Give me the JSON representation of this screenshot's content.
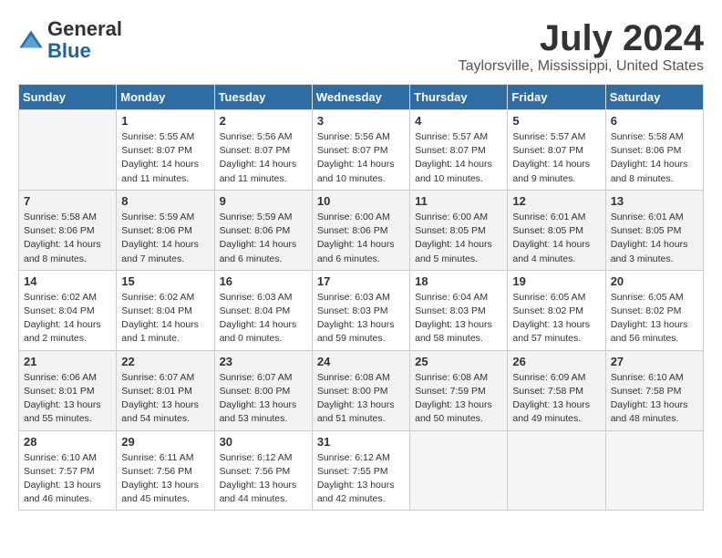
{
  "header": {
    "logo_line1": "General",
    "logo_line2": "Blue",
    "month": "July 2024",
    "location": "Taylorsville, Mississippi, United States"
  },
  "days": [
    "Sunday",
    "Monday",
    "Tuesday",
    "Wednesday",
    "Thursday",
    "Friday",
    "Saturday"
  ],
  "weeks": [
    [
      {
        "date": "",
        "sunrise": "",
        "sunset": "",
        "daylight": ""
      },
      {
        "date": "1",
        "sunrise": "Sunrise: 5:55 AM",
        "sunset": "Sunset: 8:07 PM",
        "daylight": "Daylight: 14 hours and 11 minutes."
      },
      {
        "date": "2",
        "sunrise": "Sunrise: 5:56 AM",
        "sunset": "Sunset: 8:07 PM",
        "daylight": "Daylight: 14 hours and 11 minutes."
      },
      {
        "date": "3",
        "sunrise": "Sunrise: 5:56 AM",
        "sunset": "Sunset: 8:07 PM",
        "daylight": "Daylight: 14 hours and 10 minutes."
      },
      {
        "date": "4",
        "sunrise": "Sunrise: 5:57 AM",
        "sunset": "Sunset: 8:07 PM",
        "daylight": "Daylight: 14 hours and 10 minutes."
      },
      {
        "date": "5",
        "sunrise": "Sunrise: 5:57 AM",
        "sunset": "Sunset: 8:07 PM",
        "daylight": "Daylight: 14 hours and 9 minutes."
      },
      {
        "date": "6",
        "sunrise": "Sunrise: 5:58 AM",
        "sunset": "Sunset: 8:06 PM",
        "daylight": "Daylight: 14 hours and 8 minutes."
      }
    ],
    [
      {
        "date": "7",
        "sunrise": "Sunrise: 5:58 AM",
        "sunset": "Sunset: 8:06 PM",
        "daylight": "Daylight: 14 hours and 8 minutes."
      },
      {
        "date": "8",
        "sunrise": "Sunrise: 5:59 AM",
        "sunset": "Sunset: 8:06 PM",
        "daylight": "Daylight: 14 hours and 7 minutes."
      },
      {
        "date": "9",
        "sunrise": "Sunrise: 5:59 AM",
        "sunset": "Sunset: 8:06 PM",
        "daylight": "Daylight: 14 hours and 6 minutes."
      },
      {
        "date": "10",
        "sunrise": "Sunrise: 6:00 AM",
        "sunset": "Sunset: 8:06 PM",
        "daylight": "Daylight: 14 hours and 6 minutes."
      },
      {
        "date": "11",
        "sunrise": "Sunrise: 6:00 AM",
        "sunset": "Sunset: 8:05 PM",
        "daylight": "Daylight: 14 hours and 5 minutes."
      },
      {
        "date": "12",
        "sunrise": "Sunrise: 6:01 AM",
        "sunset": "Sunset: 8:05 PM",
        "daylight": "Daylight: 14 hours and 4 minutes."
      },
      {
        "date": "13",
        "sunrise": "Sunrise: 6:01 AM",
        "sunset": "Sunset: 8:05 PM",
        "daylight": "Daylight: 14 hours and 3 minutes."
      }
    ],
    [
      {
        "date": "14",
        "sunrise": "Sunrise: 6:02 AM",
        "sunset": "Sunset: 8:04 PM",
        "daylight": "Daylight: 14 hours and 2 minutes."
      },
      {
        "date": "15",
        "sunrise": "Sunrise: 6:02 AM",
        "sunset": "Sunset: 8:04 PM",
        "daylight": "Daylight: 14 hours and 1 minute."
      },
      {
        "date": "16",
        "sunrise": "Sunrise: 6:03 AM",
        "sunset": "Sunset: 8:04 PM",
        "daylight": "Daylight: 14 hours and 0 minutes."
      },
      {
        "date": "17",
        "sunrise": "Sunrise: 6:03 AM",
        "sunset": "Sunset: 8:03 PM",
        "daylight": "Daylight: 13 hours and 59 minutes."
      },
      {
        "date": "18",
        "sunrise": "Sunrise: 6:04 AM",
        "sunset": "Sunset: 8:03 PM",
        "daylight": "Daylight: 13 hours and 58 minutes."
      },
      {
        "date": "19",
        "sunrise": "Sunrise: 6:05 AM",
        "sunset": "Sunset: 8:02 PM",
        "daylight": "Daylight: 13 hours and 57 minutes."
      },
      {
        "date": "20",
        "sunrise": "Sunrise: 6:05 AM",
        "sunset": "Sunset: 8:02 PM",
        "daylight": "Daylight: 13 hours and 56 minutes."
      }
    ],
    [
      {
        "date": "21",
        "sunrise": "Sunrise: 6:06 AM",
        "sunset": "Sunset: 8:01 PM",
        "daylight": "Daylight: 13 hours and 55 minutes."
      },
      {
        "date": "22",
        "sunrise": "Sunrise: 6:07 AM",
        "sunset": "Sunset: 8:01 PM",
        "daylight": "Daylight: 13 hours and 54 minutes."
      },
      {
        "date": "23",
        "sunrise": "Sunrise: 6:07 AM",
        "sunset": "Sunset: 8:00 PM",
        "daylight": "Daylight: 13 hours and 53 minutes."
      },
      {
        "date": "24",
        "sunrise": "Sunrise: 6:08 AM",
        "sunset": "Sunset: 8:00 PM",
        "daylight": "Daylight: 13 hours and 51 minutes."
      },
      {
        "date": "25",
        "sunrise": "Sunrise: 6:08 AM",
        "sunset": "Sunset: 7:59 PM",
        "daylight": "Daylight: 13 hours and 50 minutes."
      },
      {
        "date": "26",
        "sunrise": "Sunrise: 6:09 AM",
        "sunset": "Sunset: 7:58 PM",
        "daylight": "Daylight: 13 hours and 49 minutes."
      },
      {
        "date": "27",
        "sunrise": "Sunrise: 6:10 AM",
        "sunset": "Sunset: 7:58 PM",
        "daylight": "Daylight: 13 hours and 48 minutes."
      }
    ],
    [
      {
        "date": "28",
        "sunrise": "Sunrise: 6:10 AM",
        "sunset": "Sunset: 7:57 PM",
        "daylight": "Daylight: 13 hours and 46 minutes."
      },
      {
        "date": "29",
        "sunrise": "Sunrise: 6:11 AM",
        "sunset": "Sunset: 7:56 PM",
        "daylight": "Daylight: 13 hours and 45 minutes."
      },
      {
        "date": "30",
        "sunrise": "Sunrise: 6:12 AM",
        "sunset": "Sunset: 7:56 PM",
        "daylight": "Daylight: 13 hours and 44 minutes."
      },
      {
        "date": "31",
        "sunrise": "Sunrise: 6:12 AM",
        "sunset": "Sunset: 7:55 PM",
        "daylight": "Daylight: 13 hours and 42 minutes."
      },
      {
        "date": "",
        "sunrise": "",
        "sunset": "",
        "daylight": ""
      },
      {
        "date": "",
        "sunrise": "",
        "sunset": "",
        "daylight": ""
      },
      {
        "date": "",
        "sunrise": "",
        "sunset": "",
        "daylight": ""
      }
    ]
  ]
}
